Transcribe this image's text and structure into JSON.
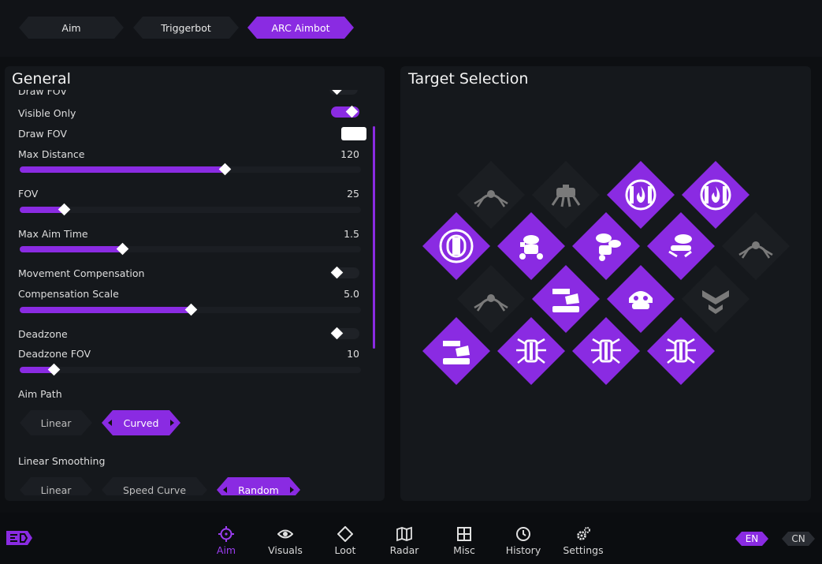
{
  "tabs": [
    {
      "label": "Aim",
      "active": false
    },
    {
      "label": "Triggerbot",
      "active": false
    },
    {
      "label": "ARC Aimbot",
      "active": true
    }
  ],
  "general": {
    "title": "General",
    "partial_top_label": "Draw FOV",
    "visible_only": {
      "label": "Visible Only",
      "on": true
    },
    "draw_fov": {
      "label": "Draw FOV",
      "color": "#ffffff"
    },
    "max_distance": {
      "label": "Max Distance",
      "value": "120",
      "fraction": 0.6
    },
    "fov": {
      "label": "FOV",
      "value": "25",
      "fraction": 0.13
    },
    "max_aim_time": {
      "label": "Max Aim Time",
      "value": "1.5",
      "fraction": 0.3
    },
    "movement_compensation": {
      "label": "Movement Compensation",
      "on": false
    },
    "compensation_scale": {
      "label": "Compensation Scale",
      "value": "5.0",
      "fraction": 0.5
    },
    "deadzone": {
      "label": "Deadzone",
      "on": false
    },
    "deadzone_fov": {
      "label": "Deadzone FOV",
      "value": "10",
      "fraction": 0.1
    },
    "aim_path": {
      "label": "Aim Path",
      "options": [
        "Linear",
        "Curved"
      ],
      "selected": "Curved"
    },
    "linear_smoothing": {
      "label": "Linear Smoothing",
      "options": [
        "Linear",
        "Speed Curve",
        "Random"
      ],
      "selected": "Random"
    }
  },
  "target_selection": {
    "title": "Target Selection",
    "targets": [
      {
        "icon": "spider-drone-icon",
        "on": false
      },
      {
        "icon": "crab-drone-icon",
        "on": false
      },
      {
        "icon": "flame-sphere-icon",
        "on": true
      },
      {
        "icon": "flame-sphere-icon",
        "on": true
      },
      {
        "icon": "sphere-icon",
        "on": true
      },
      {
        "icon": "wasp-drone-icon",
        "on": true
      },
      {
        "icon": "hornet-drone-icon",
        "on": true
      },
      {
        "icon": "flying-drone-icon",
        "on": true
      },
      {
        "icon": "spider-drone-icon",
        "on": false
      },
      {
        "icon": "spider-drone-icon",
        "on": false
      },
      {
        "icon": "turret-icon",
        "on": true
      },
      {
        "icon": "helmet-drone-icon",
        "on": true
      },
      {
        "icon": "rank-chevron-icon",
        "on": false
      },
      {
        "icon": "turret-icon",
        "on": true
      },
      {
        "icon": "tick-icon",
        "on": true
      },
      {
        "icon": "tick-icon",
        "on": true
      },
      {
        "icon": "tick-icon",
        "on": true
      }
    ]
  },
  "nav": [
    {
      "label": "Aim",
      "icon": "crosshair-icon",
      "active": true
    },
    {
      "label": "Visuals",
      "icon": "eye-icon",
      "active": false
    },
    {
      "label": "Loot",
      "icon": "diamond-icon",
      "active": false
    },
    {
      "label": "Radar",
      "icon": "map-icon",
      "active": false
    },
    {
      "label": "Misc",
      "icon": "grid-icon",
      "active": false
    },
    {
      "label": "History",
      "icon": "clock-icon",
      "active": false
    },
    {
      "label": "Settings",
      "icon": "gears-icon",
      "active": false
    }
  ],
  "languages": [
    {
      "label": "EN",
      "active": true
    },
    {
      "label": "CN",
      "active": false
    }
  ],
  "colors": {
    "accent": "#8a2be2",
    "panel": "#15181c",
    "background": "#0d0f12"
  }
}
